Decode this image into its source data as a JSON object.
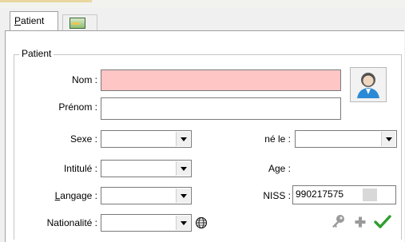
{
  "tabs": {
    "patient_label_first": "P",
    "patient_label_rest": "atient"
  },
  "group": {
    "title": "Patient"
  },
  "labels": {
    "nom": "Nom :",
    "prenom": "Prénom :",
    "sexe": "Sexe :",
    "ne_le": "né le :",
    "intitule": "Intitulé :",
    "age": "Age :",
    "langage_first": "L",
    "langage_rest": "angage :",
    "niss": "NISS :",
    "nationalite": "Nationalité :"
  },
  "values": {
    "nom": "",
    "prenom": "",
    "niss": "990217575"
  },
  "icons": {
    "tab2": "card-icon",
    "avatar": "user-icon",
    "nationality_globe": "globe-icon",
    "key": "key-icon",
    "add": "plus-icon",
    "confirm": "check-icon"
  },
  "colors": {
    "required_field": "#ffc6c6",
    "confirm_green": "#2f9e2f"
  }
}
